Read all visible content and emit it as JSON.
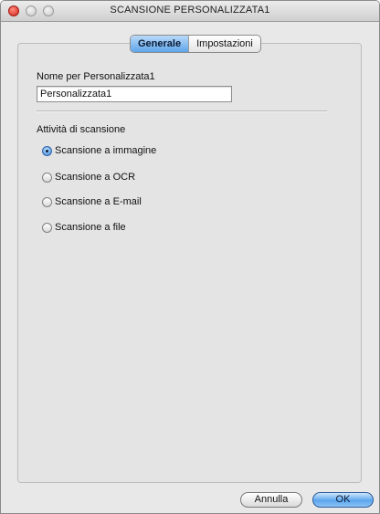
{
  "window": {
    "title": "SCANSIONE PERSONALIZZATA1"
  },
  "tabs": [
    {
      "label": "Generale",
      "active": true
    },
    {
      "label": "Impostazioni",
      "active": false
    }
  ],
  "name_field": {
    "label": "Nome per Personalizzata1",
    "value": "Personalizzata1"
  },
  "scan_activity": {
    "label": "Attività di scansione",
    "options": [
      {
        "label": "Scansione a immagine",
        "selected": true
      },
      {
        "label": "Scansione a OCR",
        "selected": false
      },
      {
        "label": "Scansione a E-mail",
        "selected": false
      },
      {
        "label": "Scansione a file",
        "selected": false
      }
    ]
  },
  "buttons": {
    "cancel": "Annulla",
    "ok": "OK"
  }
}
